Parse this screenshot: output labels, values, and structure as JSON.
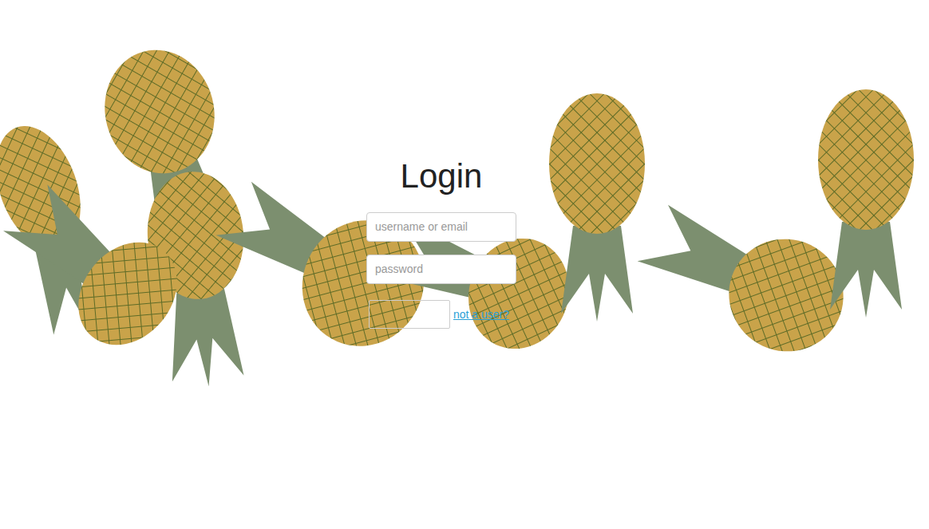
{
  "heading": "Login",
  "fields": [
    {
      "placeholder": "username or email",
      "kind": "text"
    },
    {
      "placeholder": "password",
      "kind": "password"
    }
  ],
  "signup_link": "not a user?"
}
